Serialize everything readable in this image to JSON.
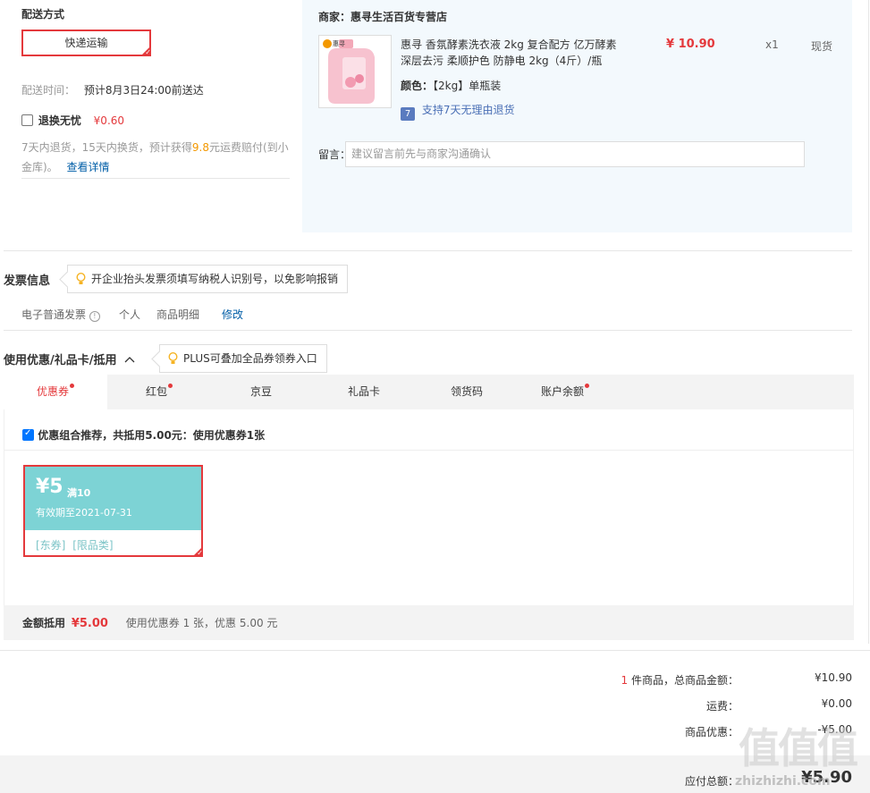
{
  "shipping": {
    "section_title": "配送方式",
    "method_label": "快递运输",
    "time_label": "配送时间：",
    "time_value": "预计8月3日24:00前送达",
    "worry_free_label": "退换无忧",
    "worry_free_price": "¥0.60",
    "worry_free_desc_1": "7天内退货，15天内换货，预计获得",
    "worry_free_amount": "9.8",
    "worry_free_desc_2": "元运费赔付(到小",
    "worry_free_desc_3": "金库)。",
    "details_link": "查看详情"
  },
  "seller": {
    "label": "商家：",
    "name": "惠寻生活百货专营店",
    "product_title_1": "惠寻 香氛酵素洗衣液 2kg 复合配方 亿万酵素",
    "product_title_2": "深层去污 柔顺护色 防静电 2kg（4斤）/瓶",
    "price": "¥ 10.90",
    "qty": "x1",
    "stock": "现货",
    "color_label": "颜色：",
    "color_value": "【2kg】单瓶装",
    "return_badge": "7",
    "return_policy": "支持7天无理由退货",
    "message_label": "留言：",
    "message_placeholder": "建议留言前先与商家沟通确认",
    "thumb_brand": "惠寻"
  },
  "invoice": {
    "section_title": "发票信息",
    "tip": "开企业抬头发票须填写纳税人识别号，以免影响报销",
    "type": "电子普通发票",
    "info_icon": "!",
    "title_type": "个人",
    "content": "商品明细",
    "edit_link": "修改"
  },
  "discount": {
    "section_title": "使用优惠/礼品卡/抵用",
    "tip": "PLUS可叠加全品券领券入口",
    "tabs": [
      {
        "label": "优惠券",
        "dot": true
      },
      {
        "label": "红包",
        "dot": true
      },
      {
        "label": "京豆",
        "dot": false
      },
      {
        "label": "礼品卡",
        "dot": false
      },
      {
        "label": "领货码",
        "dot": false
      },
      {
        "label": "账户余额",
        "dot": true
      }
    ],
    "combo_text": "优惠组合推荐，共抵用5.00元：使用优惠券1张",
    "coupon": {
      "amount": "¥5",
      "threshold": "满10",
      "validity": "有效期至2021-07-31",
      "tag_1": "[东券]",
      "tag_2": "[限品类]"
    },
    "summary_label": "金额抵用",
    "summary_amount": "¥5.00",
    "summary_detail": "使用优惠券 1 张，优惠 5.00 元"
  },
  "totals": {
    "count": "1",
    "count_suffix": " 件商品，总商品金额：",
    "goods_amount": "¥10.90",
    "freight_label": "运费：",
    "freight_amount": "¥0.00",
    "promo_label": "商品优惠：",
    "promo_amount": "-¥5.00",
    "payable_label": "应付总额：",
    "payable_amount": "¥5.90"
  },
  "watermark": {
    "text": "zhizhizhi.com"
  },
  "colors": {
    "accent_red": "#e4393c",
    "link_blue": "#005ea7",
    "coupon_teal": "#7dd3d5",
    "panel_blue": "#f3f9fd"
  }
}
